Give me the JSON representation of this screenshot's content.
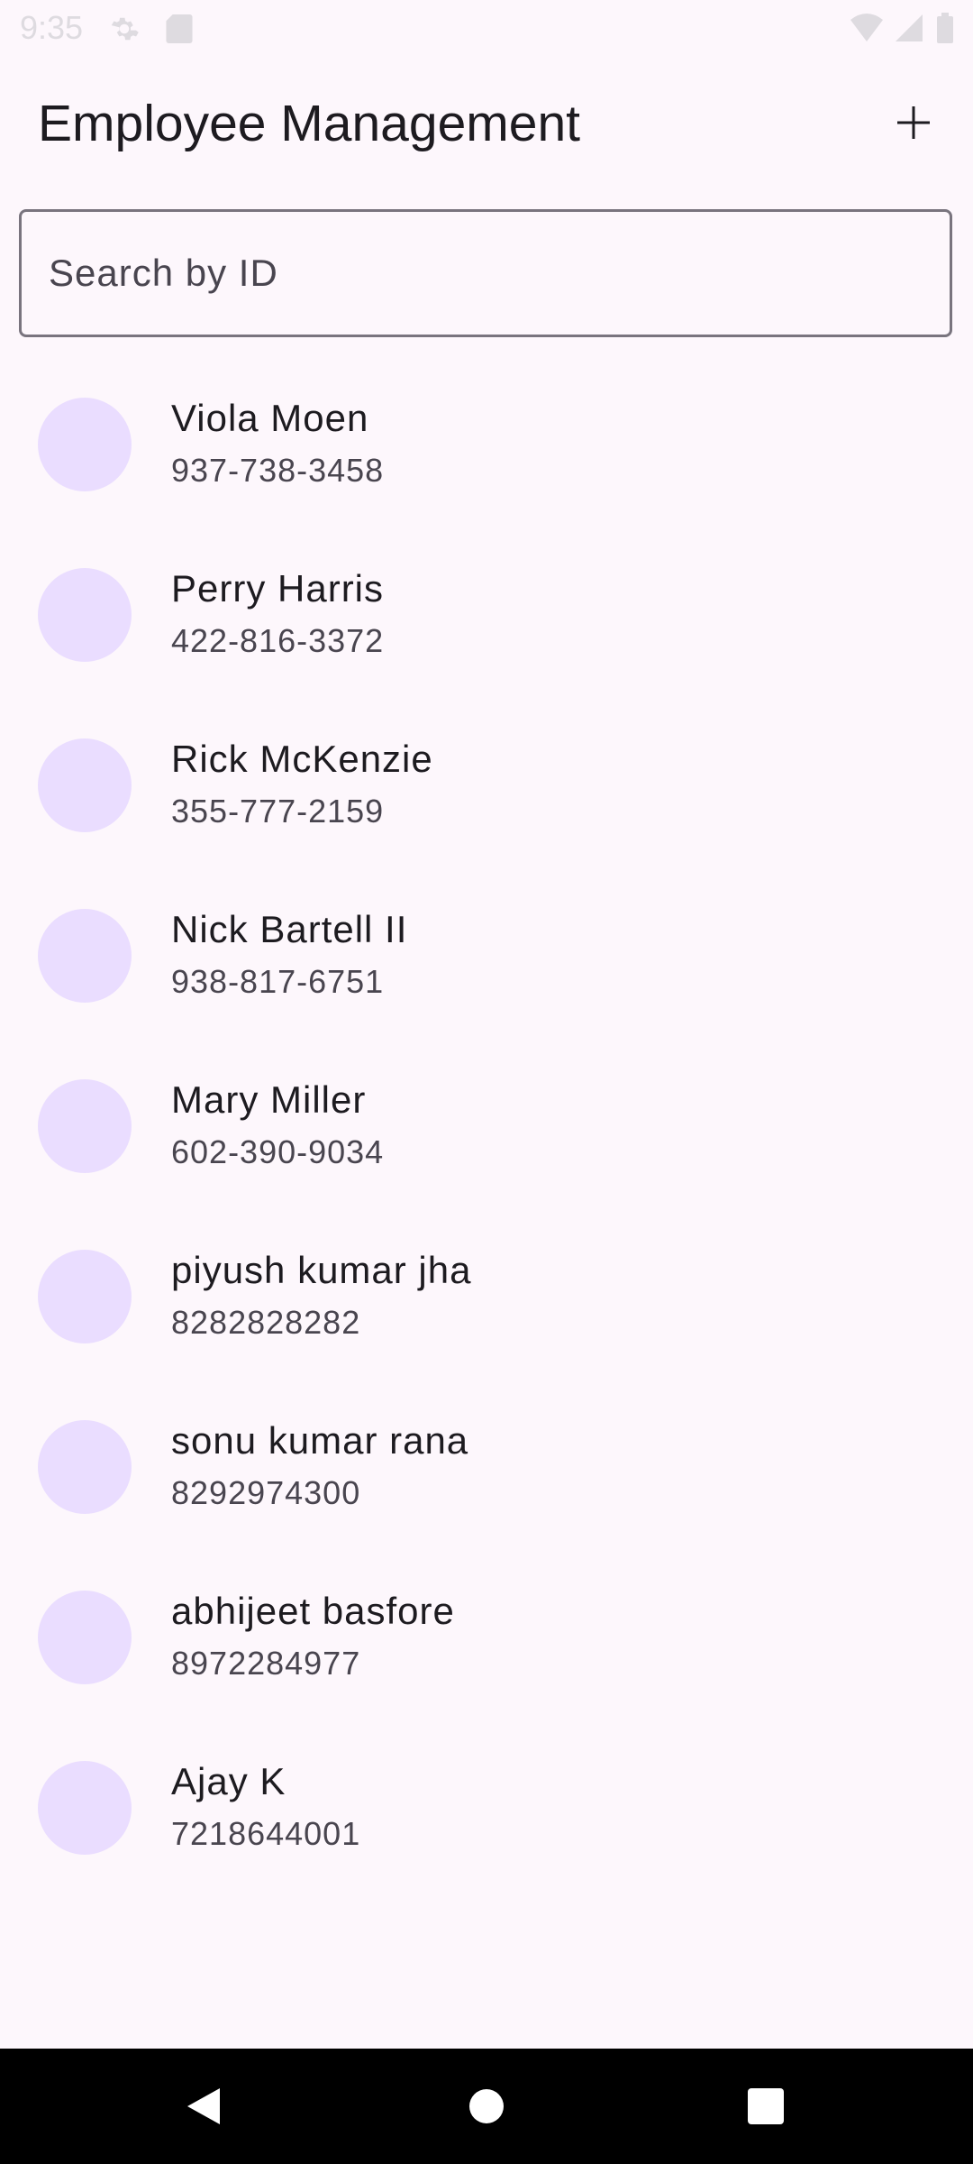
{
  "status_bar": {
    "time": "9:35",
    "icons": [
      "settings-gear-icon",
      "sim-card-icon",
      "wifi-icon",
      "cell-signal-icon",
      "battery-icon"
    ]
  },
  "app_bar": {
    "title": "Employee Management",
    "add_icon": "plus-icon"
  },
  "search": {
    "placeholder": "Search by ID",
    "value": ""
  },
  "employees": [
    {
      "name": "Viola Moen",
      "phone": "937-738-3458"
    },
    {
      "name": "Perry Harris",
      "phone": "422-816-3372"
    },
    {
      "name": "Rick McKenzie",
      "phone": "355-777-2159"
    },
    {
      "name": "Nick Bartell II",
      "phone": "938-817-6751"
    },
    {
      "name": "Mary Miller",
      "phone": "602-390-9034"
    },
    {
      "name": "piyush kumar jha",
      "phone": "8282828282"
    },
    {
      "name": "sonu kumar rana",
      "phone": "8292974300"
    },
    {
      "name": "abhijeet basfore",
      "phone": "8972284977"
    },
    {
      "name": "Ajay K",
      "phone": "7218644001"
    }
  ],
  "colors": {
    "background": "#fdf7fc",
    "avatar": "#eaddff",
    "outline": "#79747e",
    "nav_bar": "#000000"
  },
  "nav_bar": {
    "icons": [
      "back-icon",
      "home-icon",
      "recents-icon"
    ]
  }
}
